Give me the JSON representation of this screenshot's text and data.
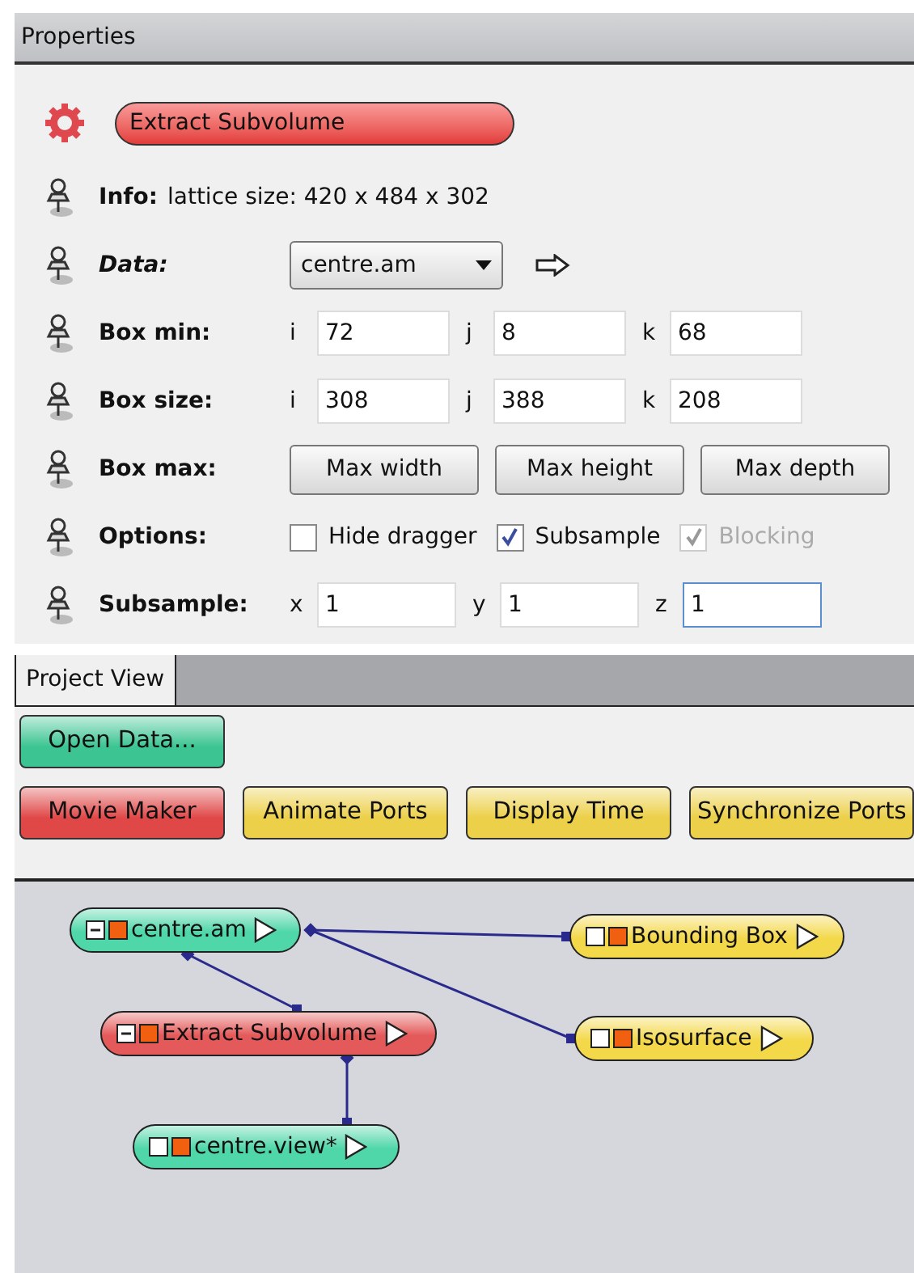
{
  "panel_title": "Properties",
  "module": {
    "name": "Extract Subvolume"
  },
  "ports": [
    {
      "kind": "info",
      "label": "Info:",
      "italic": false,
      "value": "lattice size: 420 x 484 x 302"
    },
    {
      "kind": "select",
      "label": "Data:",
      "italic": true,
      "value": "centre.am"
    },
    {
      "kind": "fields",
      "label": "Box min:",
      "italic": false,
      "fields": [
        {
          "axis": "i",
          "value": "72",
          "focused": false
        },
        {
          "axis": "j",
          "value": "8",
          "focused": false
        },
        {
          "axis": "k",
          "value": "68",
          "focused": false
        }
      ]
    },
    {
      "kind": "fields",
      "label": "Box size:",
      "italic": false,
      "fields": [
        {
          "axis": "i",
          "value": "308",
          "focused": false
        },
        {
          "axis": "j",
          "value": "388",
          "focused": false
        },
        {
          "axis": "k",
          "value": "208",
          "focused": false
        }
      ]
    },
    {
      "kind": "buttons",
      "label": "Box max:",
      "italic": false,
      "buttons": [
        "Max width",
        "Max height",
        "Max depth"
      ]
    },
    {
      "kind": "checkboxes",
      "label": "Options:",
      "italic": false,
      "options": [
        {
          "label": "Hide dragger",
          "checked": false,
          "disabled": false
        },
        {
          "label": "Subsample",
          "checked": true,
          "disabled": false
        },
        {
          "label": "Blocking",
          "checked": true,
          "disabled": true
        }
      ]
    },
    {
      "kind": "fields",
      "label": "Subsample:",
      "italic": false,
      "fields": [
        {
          "axis": "x",
          "value": "1",
          "focused": false
        },
        {
          "axis": "y",
          "value": "1",
          "focused": false
        },
        {
          "axis": "z",
          "value": "1",
          "focused": true
        }
      ]
    }
  ],
  "tabs": [
    {
      "label": "Project View",
      "selected": true
    }
  ],
  "toolbar_rows": [
    [
      {
        "label": "Open Data...",
        "color": "#3cc592"
      }
    ],
    [
      {
        "label": "Movie Maker",
        "color": "#e04848"
      },
      {
        "label": "Animate Ports",
        "color": "#ecd04a"
      },
      {
        "label": "Display Time",
        "color": "#ecd04a"
      },
      {
        "label": "Synchronize Ports",
        "color": "#ecd04a"
      }
    ]
  ],
  "nodes": [
    {
      "label": "centre.am",
      "color": "#4fd6a9",
      "expanded": true
    },
    {
      "label": "Bounding Box",
      "color": "#f3d84a",
      "expanded": false
    },
    {
      "label": "Extract Subvolume",
      "color": "#e45a5a",
      "expanded": true
    },
    {
      "label": "Isosurface",
      "color": "#f3d84a",
      "expanded": false
    },
    {
      "label": "centre.view*",
      "color": "#4fd6a9",
      "expanded": false
    }
  ]
}
